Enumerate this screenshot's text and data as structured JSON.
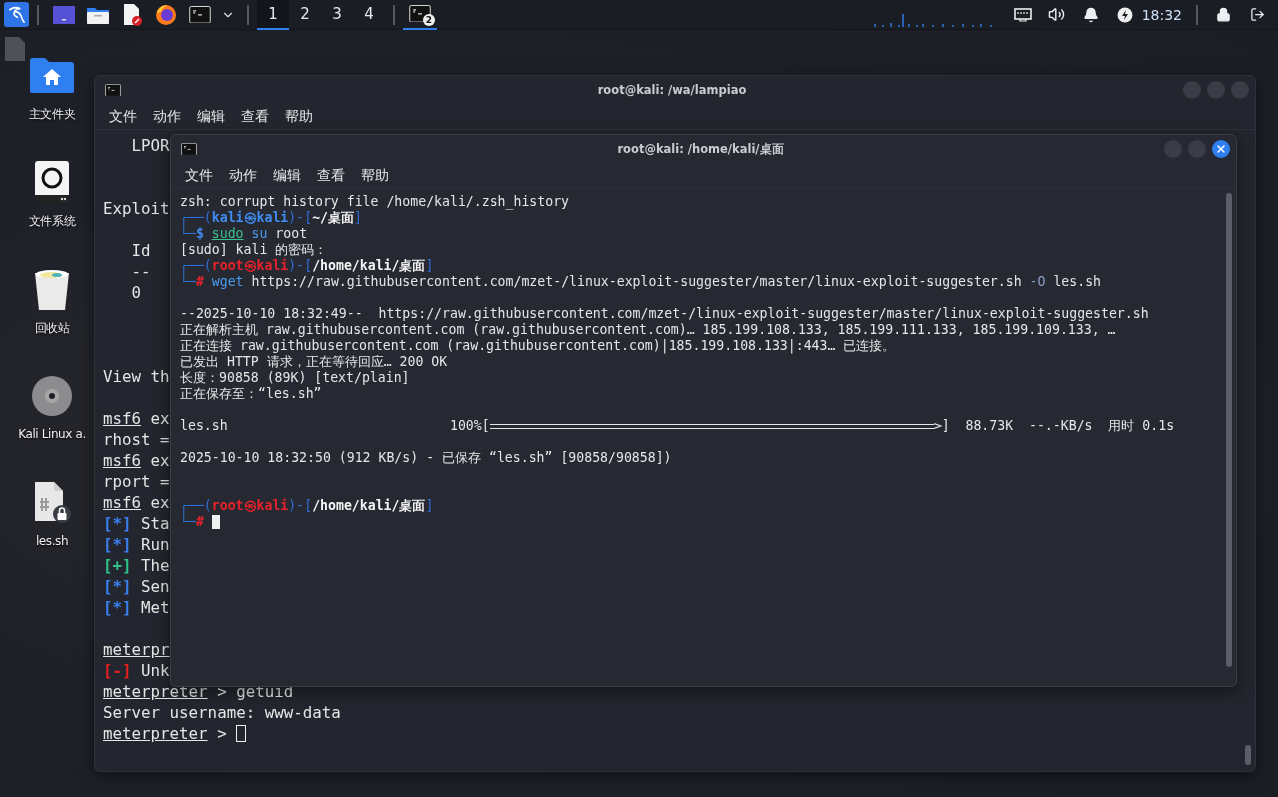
{
  "taskbar": {
    "workspaces": [
      {
        "label": "1",
        "selected": true
      },
      {
        "label": "2",
        "selected": false
      },
      {
        "label": "3",
        "selected": false
      },
      {
        "label": "4",
        "selected": false
      }
    ],
    "task": {
      "badge": "2",
      "selected": true
    },
    "clock": "18:32"
  },
  "desktop_icons": [
    {
      "label": "主文件夹",
      "kind": "home"
    },
    {
      "label": "文件系统",
      "kind": "drive"
    },
    {
      "label": "回收站",
      "kind": "trash"
    },
    {
      "label": "Kali Linux a.",
      "kind": "disc"
    },
    {
      "label": "les.sh",
      "kind": "script"
    }
  ],
  "back_window": {
    "title": "root@kali: /wa/lampiao",
    "focused": false,
    "menu": [
      "文件",
      "动作",
      "编辑",
      "查看",
      "帮助"
    ],
    "lines": [
      {
        "kind": "text",
        "segments": [
          {
            "text": "   LPOR",
            "kind": "plain"
          }
        ]
      },
      {
        "kind": "blank"
      },
      {
        "kind": "blank"
      },
      {
        "kind": "text",
        "segments": [
          {
            "text": "Exploit",
            "kind": "plain"
          }
        ]
      },
      {
        "kind": "blank"
      },
      {
        "kind": "text",
        "segments": [
          {
            "text": "   Id",
            "kind": "plain"
          }
        ]
      },
      {
        "kind": "text",
        "segments": [
          {
            "text": "   --",
            "kind": "plain"
          }
        ]
      },
      {
        "kind": "text",
        "segments": [
          {
            "text": "   0",
            "kind": "plain"
          }
        ]
      },
      {
        "kind": "blank"
      },
      {
        "kind": "blank"
      },
      {
        "kind": "blank"
      },
      {
        "kind": "text",
        "segments": [
          {
            "text": "View th",
            "kind": "plain"
          }
        ]
      },
      {
        "kind": "blank"
      },
      {
        "kind": "text",
        "segments": [
          {
            "text": "msf6",
            "kind": "prompt"
          },
          {
            "text": " ex",
            "kind": "plain"
          }
        ]
      },
      {
        "kind": "text",
        "segments": [
          {
            "text": "rhost =",
            "kind": "plain"
          }
        ]
      },
      {
        "kind": "text",
        "segments": [
          {
            "text": "msf6",
            "kind": "prompt"
          },
          {
            "text": " ex",
            "kind": "plain"
          }
        ]
      },
      {
        "kind": "text",
        "segments": [
          {
            "text": "rport =",
            "kind": "plain"
          }
        ]
      },
      {
        "kind": "text",
        "segments": [
          {
            "text": "msf6",
            "kind": "prompt"
          },
          {
            "text": " ex",
            "kind": "plain"
          }
        ]
      },
      {
        "kind": "text",
        "segments": [
          {
            "text": "[*]",
            "kind": "info"
          },
          {
            "text": " Sta",
            "kind": "plain"
          }
        ]
      },
      {
        "kind": "text",
        "segments": [
          {
            "text": "[*]",
            "kind": "info"
          },
          {
            "text": " Run",
            "kind": "plain"
          }
        ]
      },
      {
        "kind": "text",
        "segments": [
          {
            "text": "[+]",
            "kind": "good"
          },
          {
            "text": " The",
            "kind": "plain"
          }
        ]
      },
      {
        "kind": "text",
        "segments": [
          {
            "text": "[*]",
            "kind": "info"
          },
          {
            "text": " Sen",
            "kind": "plain"
          }
        ]
      },
      {
        "kind": "text",
        "segments": [
          {
            "text": "[*]",
            "kind": "info"
          },
          {
            "text": " Met",
            "kind": "plain"
          }
        ]
      },
      {
        "kind": "blank"
      },
      {
        "kind": "text",
        "segments": [
          {
            "text": "meterpr",
            "kind": "prompt"
          }
        ]
      },
      {
        "kind": "text",
        "segments": [
          {
            "text": "[-]",
            "kind": "error"
          },
          {
            "text": " Unk",
            "kind": "plain"
          }
        ]
      },
      {
        "kind": "text",
        "segments": [
          {
            "text": "meterpreter",
            "kind": "prompt"
          },
          {
            "text": " > getuid",
            "kind": "plain"
          }
        ]
      },
      {
        "kind": "text",
        "segments": [
          {
            "text": "Server username: www-data",
            "kind": "plain"
          }
        ]
      },
      {
        "kind": "text",
        "segments": [
          {
            "text": "meterpreter",
            "kind": "prompt"
          },
          {
            "text": " > ",
            "kind": "plain"
          },
          {
            "kind": "cursor"
          }
        ]
      }
    ]
  },
  "front_window": {
    "title": "root@kali: /home/kali/桌面",
    "focused": true,
    "menu": [
      "文件",
      "动作",
      "编辑",
      "查看",
      "帮助"
    ],
    "lines": [
      {
        "kind": "text",
        "segments": [
          {
            "text": "zsh: corrupt history file /home/kali/.zsh_history",
            "kind": "plain"
          }
        ]
      },
      {
        "kind": "text",
        "segments": [
          {
            "text": "┌──(",
            "kind": "frame"
          },
          {
            "text": "kali㉿kali",
            "kind": "user_kali"
          },
          {
            "text": ")-[",
            "kind": "frame"
          },
          {
            "text": "~/桌面",
            "kind": "path"
          },
          {
            "text": "]",
            "kind": "frame"
          }
        ]
      },
      {
        "kind": "text",
        "segments": [
          {
            "text": "└─",
            "kind": "frame"
          },
          {
            "text": "$ ",
            "kind": "user_kali"
          },
          {
            "text": "sudo",
            "kind": "sudo"
          },
          {
            "text": " su",
            "kind": "command"
          },
          {
            "text": " root",
            "kind": "plain"
          }
        ]
      },
      {
        "kind": "text",
        "segments": [
          {
            "text": "[sudo] kali 的密码：",
            "kind": "plain"
          }
        ]
      },
      {
        "kind": "text",
        "segments": [
          {
            "text": "┌──(",
            "kind": "frame"
          },
          {
            "text": "root㉿kali",
            "kind": "user_root"
          },
          {
            "text": ")-[",
            "kind": "frame"
          },
          {
            "text": "/home/kali/桌面",
            "kind": "path"
          },
          {
            "text": "]",
            "kind": "frame"
          }
        ]
      },
      {
        "kind": "text",
        "segments": [
          {
            "text": "└─",
            "kind": "frame"
          },
          {
            "text": "#",
            "kind": "user_root"
          },
          {
            "text": " wget",
            "kind": "command"
          },
          {
            "text": " https://raw.githubusercontent.com/mzet-/linux-exploit-suggester/master/linux-exploit-suggester.sh",
            "kind": "plain"
          },
          {
            "text": " -O",
            "kind": "option"
          },
          {
            "text": " les.sh",
            "kind": "plain"
          }
        ]
      },
      {
        "kind": "blank"
      },
      {
        "kind": "text",
        "segments": [
          {
            "text": "--2025-10-10 18:32:49--  https://raw.githubusercontent.com/mzet-/linux-exploit-suggester/master/linux-exploit-suggester.sh",
            "kind": "plain"
          }
        ]
      },
      {
        "kind": "text",
        "segments": [
          {
            "text": "正在解析主机 raw.githubusercontent.com (raw.githubusercontent.com)… 185.199.108.133, 185.199.111.133, 185.199.109.133, …",
            "kind": "plain"
          }
        ]
      },
      {
        "kind": "text",
        "segments": [
          {
            "text": "正在连接 raw.githubusercontent.com (raw.githubusercontent.com)|185.199.108.133|:443… 已连接。",
            "kind": "plain"
          }
        ]
      },
      {
        "kind": "text",
        "segments": [
          {
            "text": "已发出 HTTP 请求，正在等待回应… 200 OK",
            "kind": "plain"
          }
        ]
      },
      {
        "kind": "text",
        "segments": [
          {
            "text": "长度：90858 (89K) [text/plain]",
            "kind": "plain"
          }
        ]
      },
      {
        "kind": "text",
        "segments": [
          {
            "text": "正在保存至：“les.sh”",
            "kind": "plain"
          }
        ]
      },
      {
        "kind": "blank"
      },
      {
        "kind": "text",
        "segments": [
          {
            "text": "les.sh                            100%[",
            "kind": "plain"
          },
          {
            "kind": "bar",
            "level": 1
          },
          {
            "text": "]  88.73K  --.-KB/s  用时 0.1s",
            "kind": "plain"
          }
        ]
      },
      {
        "kind": "blank"
      },
      {
        "kind": "text",
        "segments": [
          {
            "text": "2025-10-10 18:32:50 (912 KB/s) - 已保存 “les.sh” [90858/90858])",
            "kind": "plain"
          }
        ]
      },
      {
        "kind": "blank"
      },
      {
        "kind": "blank"
      },
      {
        "kind": "text",
        "segments": [
          {
            "text": "┌──(",
            "kind": "frame"
          },
          {
            "text": "root㉿kali",
            "kind": "user_root"
          },
          {
            "text": ")-[",
            "kind": "frame"
          },
          {
            "text": "/home/kali/桌面",
            "kind": "path"
          },
          {
            "text": "]",
            "kind": "frame"
          }
        ]
      },
      {
        "kind": "text",
        "segments": [
          {
            "text": "└─",
            "kind": "frame"
          },
          {
            "text": "# ",
            "kind": "user_root"
          },
          {
            "kind": "cursor"
          }
        ]
      }
    ]
  }
}
